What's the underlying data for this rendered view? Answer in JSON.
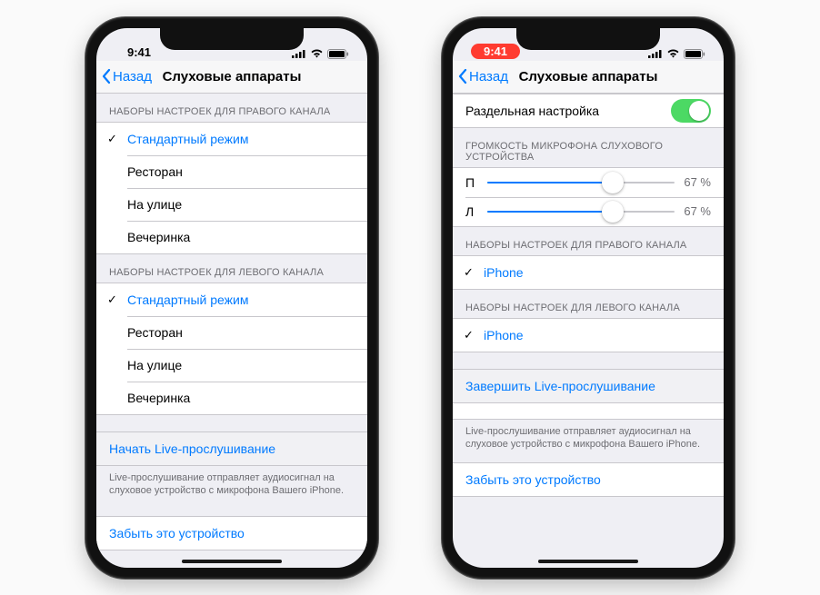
{
  "status": {
    "time": "9:41"
  },
  "nav": {
    "back": "Назад",
    "title": "Слуховые аппараты"
  },
  "left": {
    "sectionRight": "НАБОРЫ НАСТРОЕК ДЛЯ ПРАВОГО КАНАЛА",
    "sectionLeft": "НАБОРЫ НАСТРОЕК ДЛЯ ЛЕВОГО КАНАЛА",
    "presets": {
      "standard": "Стандартный режим",
      "restaurant": "Ресторан",
      "outdoor": "На улице",
      "party": "Вечеринка"
    },
    "startLive": "Начать Live-прослушивание",
    "liveFooter": "Live-прослушивание отправляет аудиосигнал на слуховое устройство с микрофона Вашего iPhone.",
    "forget": "Забыть это устройство"
  },
  "right": {
    "separate": "Раздельная настройка",
    "micVolume": "ГРОМКОСТЬ МИКРОФОНА СЛУХОВОГО УСТРОЙСТВА",
    "sliderR": {
      "label": "П",
      "percent": 67,
      "display": "67 %"
    },
    "sliderL": {
      "label": "Л",
      "percent": 67,
      "display": "67 %"
    },
    "sectionRight": "НАБОРЫ НАСТРОЕК ДЛЯ ПРАВОГО КАНАЛА",
    "sectionLeft": "НАБОРЫ НАСТРОЕК ДЛЯ ЛЕВОГО КАНАЛА",
    "presetIphone": "iPhone",
    "endLive": "Завершить Live-прослушивание",
    "liveFooter": "Live-прослушивание отправляет аудиосигнал на слуховое устройство с микрофона Вашего iPhone.",
    "forget": "Забыть это устройство"
  }
}
